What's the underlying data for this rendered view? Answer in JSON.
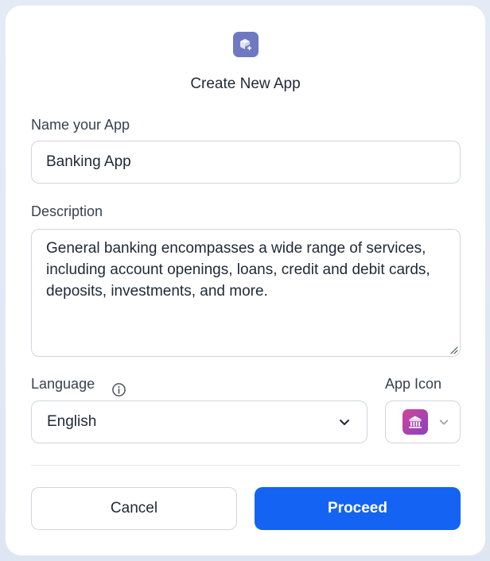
{
  "dialog": {
    "title": "Create New App",
    "logo_icon": "package-add-icon"
  },
  "name_field": {
    "label": "Name your App",
    "value": "Banking App"
  },
  "description_field": {
    "label": "Description",
    "value": "General banking encompasses a wide range of services, including account openings, loans, credit and debit cards, deposits, investments, and more."
  },
  "language_field": {
    "label": "Language",
    "info_icon": "info-icon",
    "selected": "English",
    "dropdown_icon": "chevron-down-icon"
  },
  "app_icon_field": {
    "label": "App Icon",
    "selected_icon": "bank-icon",
    "dropdown_icon": "chevron-down-icon"
  },
  "actions": {
    "cancel_label": "Cancel",
    "proceed_label": "Proceed"
  },
  "colors": {
    "primary": "#1463f3",
    "logo_bg": "#6f79c2",
    "app_icon_gradient_start": "#d0469a",
    "app_icon_gradient_end": "#8b3fbf"
  }
}
